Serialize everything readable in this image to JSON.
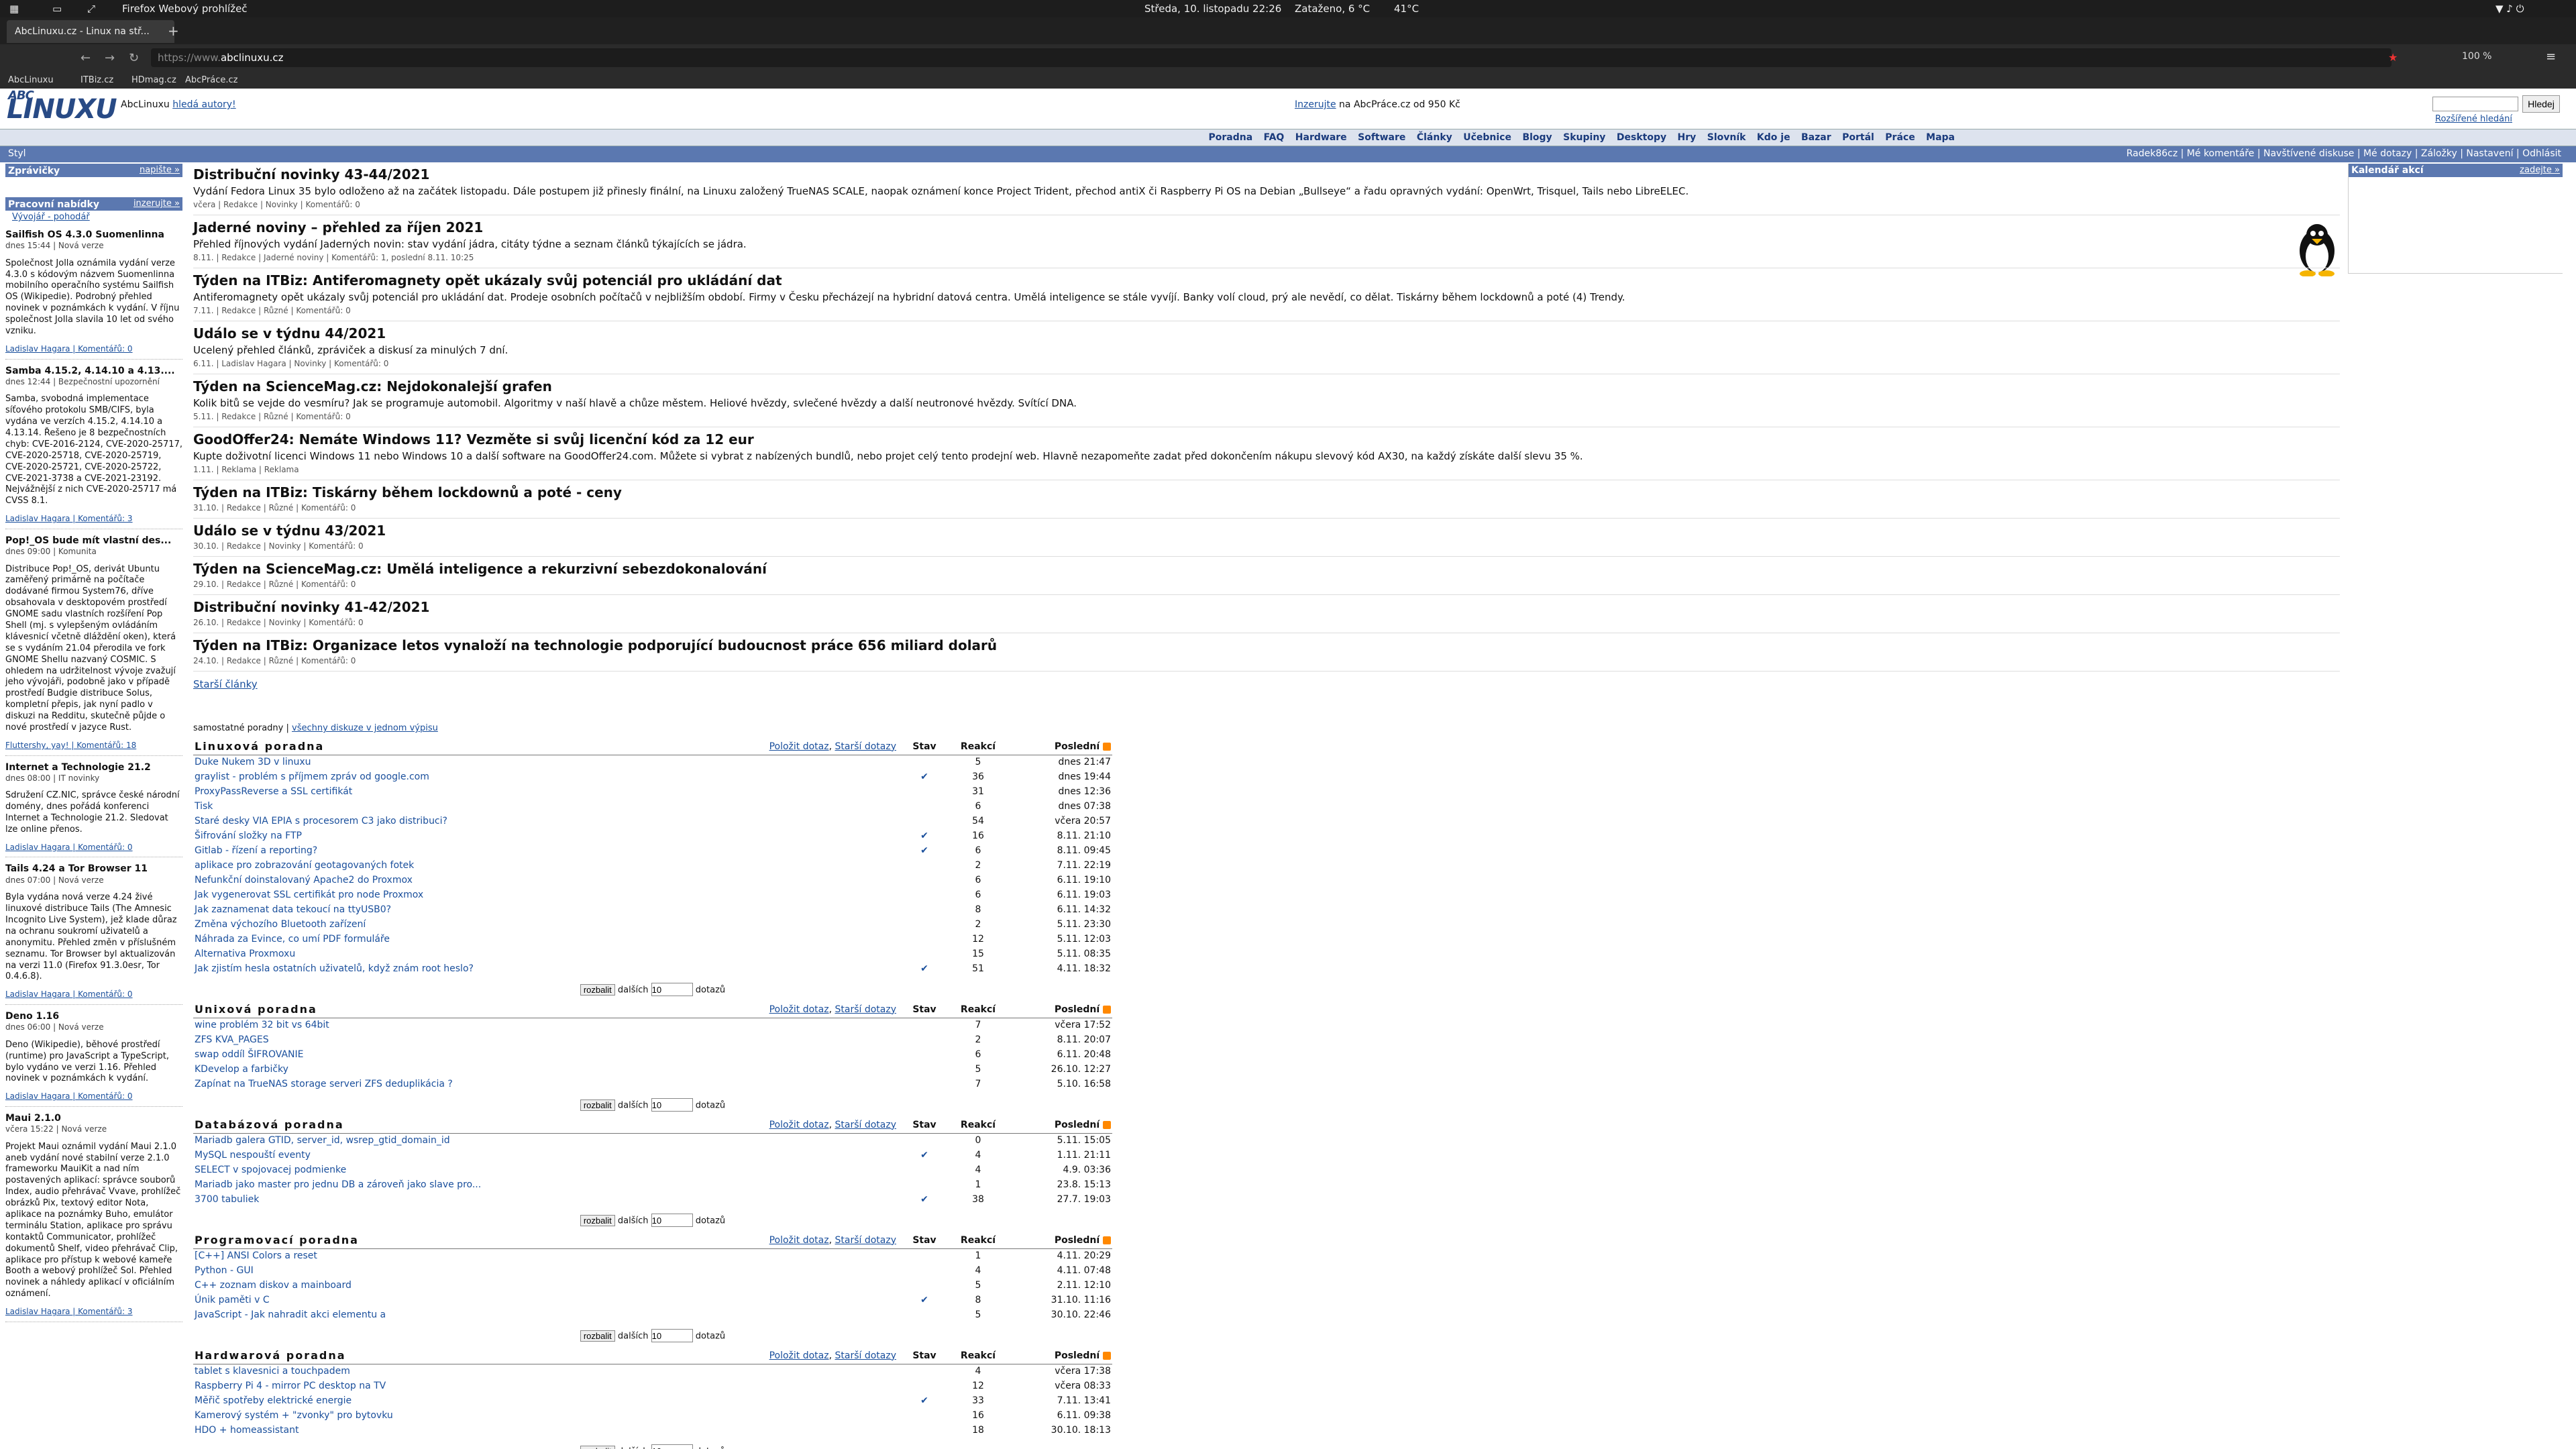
{
  "system_bar": {
    "activities": "Firefox Webový prohlížeč",
    "clock": "Středa, 10. listopadu  22:26",
    "weather": "Zataženo, 6 °C",
    "temp": "41°C"
  },
  "browser": {
    "tab_title": "AbcLinuxu.cz - Linux na stř...",
    "url_prefix": "https://www.",
    "url_domain": "abclinuxu.cz",
    "zoom": "100 %",
    "bookmarks": [
      "AbcLinuxu",
      "ITBiz.cz",
      "HDmag.cz",
      "AbcPráce.cz"
    ]
  },
  "site": {
    "logo_top": "ABC",
    "logo": "LINUXU",
    "slogan_prefix": "AbcLinuxu ",
    "slogan_link": "hledá autory!",
    "ad_link": "Inzerujte",
    "ad_text": " na AbcPráce.cz od 950 Kč",
    "search_button": "Hledej",
    "search_advanced": "Rozšířené hledání",
    "menu": [
      "Poradna",
      "FAQ",
      "Hardware",
      "Software",
      "Články",
      "Učebnice",
      "Blogy",
      "Skupiny",
      "Desktopy",
      "Hry",
      "Slovník",
      "Kdo je",
      "Bazar",
      "Portál",
      "Práce",
      "Mapa"
    ],
    "style_label": "Styl",
    "user_menu": "Radek86cz | Mé komentáře | Navštívené diskuse | Mé dotazy | Záložky | Nastavení | Odhlásit"
  },
  "left": {
    "zpravicky": "Zprávičky",
    "napiste": "napište »",
    "nabidky": "Pracovní nabídky",
    "inzerujte": "inzerujte »",
    "job": "Vývojář - pohodář",
    "news": [
      {
        "title": "Sailfish OS 4.3.0 Suomenlinna",
        "meta": "dnes 15:44 | Nová verze",
        "text": "Společnost Jolla oznámila vydání verze 4.3.0 s kódovým názvem Suomenlinna mobilního operačního systému Sailfish OS (Wikipedie). Podrobný přehled novinek v poznámkách k vydání. V říjnu společnost Jolla slavila 10 let od svého vzniku.",
        "foot": "Ladislav Hagara | Komentářů: 0"
      },
      {
        "title": "Samba 4.15.2, 4.14.10 a 4.13....",
        "meta": "dnes 12:44 | Bezpečnostní upozornění",
        "text": "Samba, svobodná implementace síťového protokolu SMB/CIFS, byla vydána ve verzích 4.15.2, 4.14.10 a 4.13.14. Řešeno je 8 bezpečnostních chyb: CVE-2016-2124, CVE-2020-25717, CVE-2020-25718, CVE-2020-25719, CVE-2020-25721, CVE-2020-25722, CVE-2021-3738 a CVE-2021-23192. Nejvážnější z nich CVE-2020-25717 má CVSS 8.1.",
        "foot": "Ladislav Hagara | Komentářů: 3"
      },
      {
        "title": "Pop!_OS bude mít vlastní des...",
        "meta": "dnes 09:00 | Komunita",
        "text": "Distribuce Pop!_OS, derivát Ubuntu zaměřený primárně na počítače dodávané firmou System76, dříve obsahovala v desktopovém prostředí GNOME sadu vlastních rozšíření Pop Shell (mj. s vylepšeným ovládáním klávesnicí včetně dláždění oken), která se s vydáním 21.04 přerodila ve fork GNOME Shellu nazvaný COSMIC. S ohledem na udržitelnost vývoje zvažují jeho vývojáři, podobně jako v případě prostředí Budgie distribuce Solus, kompletní přepis, jak nyní padlo v diskuzi na Redditu, skutečně půjde o nové prostředí v jazyce Rust.",
        "foot": "Fluttershy, yay! | Komentářů: 18"
      },
      {
        "title": "Internet a Technologie 21.2",
        "meta": "dnes 08:00 | IT novinky",
        "text": "Sdružení CZ.NIC, správce české národní domény, dnes pořádá konferenci Internet a Technologie 21.2. Sledovat lze online přenos.",
        "foot": "Ladislav Hagara | Komentářů: 0"
      },
      {
        "title": "Tails 4.24 a Tor Browser 11",
        "meta": "dnes 07:00 | Nová verze",
        "text": "Byla vydána nová verze 4.24 živé linuxové distribuce Tails (The Amnesic Incognito Live System), jež klade důraz na ochranu soukromí uživatelů a anonymitu. Přehled změn v příslušném seznamu. Tor Browser byl aktualizován na verzi 11.0 (Firefox 91.3.0esr, Tor 0.4.6.8).",
        "foot": "Ladislav Hagara | Komentářů: 0"
      },
      {
        "title": "Deno 1.16",
        "meta": "dnes 06:00 | Nová verze",
        "text": "Deno (Wikipedie), běhové prostředí (runtime) pro JavaScript a TypeScript, bylo vydáno ve verzi 1.16. Přehled novinek v poznámkách k vydání.",
        "foot": "Ladislav Hagara | Komentářů: 0"
      },
      {
        "title": "Maui 2.1.0",
        "meta": "včera 15:22 | Nová verze",
        "text": "Projekt Maui oznámil vydání Maui 2.1.0 aneb vydání nové stabilní verze 2.1.0 frameworku MauiKit a nad ním postavených aplikací: správce souborů Index, audio přehrávač Vvave, prohlížeč obrázků Pix, textový editor Nota, aplikace na poznámky Buho, emulátor terminálu Station, aplikace pro správu kontaktů Communicator, prohlížeč dokumentů Shelf, video přehrávač Clip, aplikace pro přístup k webové kameře Booth a webový prohlížeč Sol. Přehled novinek a náhledy aplikací v oficiálním oznámení.",
        "foot": "Ladislav Hagara | Komentářů: 3"
      }
    ]
  },
  "calendar": {
    "title": "Kalendář akcí",
    "link": "zadejte »"
  },
  "articles": [
    {
      "title": "Distribuční novinky 43-44/2021",
      "text": "Vydání Fedora Linux 35 bylo odloženo až na začátek listopadu. Dále postupem již přinesly finální, na Linuxu založený TrueNAS SCALE, naopak oznámení konce Project Trident, přechod antiX či Raspberry Pi OS na Debian „Bullseye“ a řadu opravných vydání: OpenWrt, Trisquel, Tails nebo LibreELEC.",
      "meta": "včera | Redakce | Novinky | Komentářů: 0"
    },
    {
      "title": "Jaderné noviny – přehled za říjen 2021",
      "text": "Přehled říjnových vydání Jaderných novin: stav vydání jádra, citáty týdne a seznam článků týkajících se jádra.",
      "meta": "8.11. | Redakce | Jaderné noviny | Komentářů: 1, poslední 8.11. 10:25"
    },
    {
      "title": "Týden na ITBiz: Antiferomagnety opět ukázaly svůj potenciál pro ukládání dat",
      "text": "Antiferomagnety opět ukázaly svůj potenciál pro ukládání dat. Prodeje osobních počítačů v nejbližším období. Firmy v Česku přecházejí na hybridní datová centra. Umělá inteligence se stále vyvíjí. Banky volí cloud, prý ale nevědí, co dělat. Tiskárny během lockdownů a poté (4) Trendy.",
      "meta": "7.11. | Redakce | Různé | Komentářů: 0"
    },
    {
      "title": "Událo se v týdnu 44/2021",
      "text": "Ucelený přehled článků, zpráviček a diskusí za minulých 7 dní.",
      "meta": "6.11. | Ladislav Hagara | Novinky | Komentářů: 0"
    },
    {
      "title": "Týden na ScienceMag.cz: Nejdokonalejší grafen",
      "text": "Kolik bitů se vejde do vesmíru? Jak se programuje automobil. Algoritmy v naší hlavě a chůze městem. Heliové hvězdy, svlečené hvězdy a další neutronové hvězdy. Svítící DNA.",
      "meta": "5.11. | Redakce | Různé | Komentářů: 0"
    },
    {
      "title": "GoodOffer24: Nemáte Windows 11? Vezměte si svůj licenční kód za 12 eur",
      "text": "Kupte doživotní licenci Windows 11 nebo Windows 10 a další software na GoodOffer24.com. Můžete si vybrat z nabízených bundlů, nebo projet celý tento prodejní web. Hlavně nezapomeňte zadat před dokončením nákupu slevový kód AX30, na každý získáte další slevu 35 %.",
      "meta": "1.11. | Reklama | Reklama"
    },
    {
      "title": "Týden na ITBiz: Tiskárny během lockdownů a poté - ceny",
      "text": "",
      "meta": "31.10. | Redakce | Různé | Komentářů: 0"
    },
    {
      "title": "Událo se v týdnu 43/2021",
      "text": "",
      "meta": "30.10. | Redakce | Novinky | Komentářů: 0"
    },
    {
      "title": "Týden na ScienceMag.cz: Umělá inteligence a rekurzivní sebezdokonalování",
      "text": "",
      "meta": "29.10. | Redakce | Různé | Komentářů: 0"
    },
    {
      "title": "Distribuční novinky 41-42/2021",
      "text": "",
      "meta": "26.10. | Redakce | Novinky | Komentářů: 0"
    },
    {
      "title": "Týden na ITBiz: Organizace letos vynaloží na technologie podporující budoucnost práce 656 miliard dolarů",
      "text": "",
      "meta": "24.10. | Redakce | Různé | Komentářů: 0"
    }
  ],
  "older_articles": "Starší články",
  "forums_intro_a": "samostatné poradny | ",
  "forums_intro_b": "všechny diskuze v jednom výpisu",
  "forum_cols": {
    "stav": "Stav",
    "reakci": "Reakcí",
    "posledni": "Poslední",
    "ask": "Položit dotaz",
    "older": "Starší dotazy"
  },
  "forum_ctl": {
    "btn": "rozbalit",
    "dalsich": "dalších",
    "value": "10",
    "dotazu": "dotazů"
  },
  "forums": [
    {
      "name": "Linuxová poradna",
      "rows": [
        [
          "Duke Nukem 3D v linuxu",
          "",
          "5",
          "dnes 21:47"
        ],
        [
          "graylist - problém s příjmem zpráv od google.com",
          "✔",
          "36",
          "dnes 19:44"
        ],
        [
          "ProxyPassReverse a SSL certifikát",
          "",
          "31",
          "dnes 12:36"
        ],
        [
          "Tisk",
          "",
          "6",
          "dnes 07:38"
        ],
        [
          "Staré desky VIA EPIA s procesorem C3 jako distribuci?",
          "",
          "54",
          "včera 20:57"
        ],
        [
          "Šifrování složky na FTP",
          "✔",
          "16",
          "8.11. 21:10"
        ],
        [
          "Gitlab - řízení a reporting?",
          "✔",
          "6",
          "8.11. 09:45"
        ],
        [
          "aplikace pro zobrazování geotagovaných fotek",
          "",
          "2",
          "7.11. 22:19"
        ],
        [
          "Nefunkční doinstalovaný Apache2 do Proxmox",
          "",
          "6",
          "6.11. 19:10"
        ],
        [
          "Jak vygenerovat SSL certifikát pro node Proxmox",
          "",
          "6",
          "6.11. 19:03"
        ],
        [
          "Jak zaznamenat data tekoucí na ttyUSB0?",
          "",
          "8",
          "6.11. 14:32"
        ],
        [
          "Změna výchozího Bluetooth zařízení",
          "",
          "2",
          "5.11. 23:30"
        ],
        [
          "Náhrada za Evince, co umí PDF formuláře",
          "",
          "12",
          "5.11. 12:03"
        ],
        [
          "Alternativa Proxmoxu",
          "",
          "15",
          "5.11. 08:35"
        ],
        [
          "Jak zjistím hesla ostatních uživatelů, když znám root heslo?",
          "✔",
          "51",
          "4.11. 18:32"
        ]
      ]
    },
    {
      "name": "Unixová poradna",
      "rows": [
        [
          "wine problém 32 bit vs 64bit",
          "",
          "7",
          "včera 17:52"
        ],
        [
          "ZFS KVA_PAGES",
          "",
          "2",
          "8.11. 20:07"
        ],
        [
          "swap oddíl ŠIFROVANIE",
          "",
          "6",
          "6.11. 20:48"
        ],
        [
          "KDevelop a farbičky",
          "",
          "5",
          "26.10. 12:27"
        ],
        [
          "Zapínat na TrueNAS storage serveri ZFS deduplikácia ?",
          "",
          "7",
          "5.10. 16:58"
        ]
      ]
    },
    {
      "name": "Databázová poradna",
      "rows": [
        [
          "Mariadb galera GTID, server_id, wsrep_gtid_domain_id",
          "",
          "0",
          "5.11. 15:05"
        ],
        [
          "MySQL nespouští eventy",
          "✔",
          "4",
          "1.11. 21:11"
        ],
        [
          "SELECT v spojovacej podmienke",
          "",
          "4",
          "4.9. 03:36"
        ],
        [
          "Mariadb jako master pro jednu DB a zároveň jako slave pro...",
          "",
          "1",
          "23.8. 15:13"
        ],
        [
          "3700 tabuliek",
          "✔",
          "38",
          "27.7. 19:03"
        ]
      ]
    },
    {
      "name": "Programovací poradna",
      "rows": [
        [
          "[C++] ANSI Colors a reset",
          "",
          "1",
          "4.11. 20:29"
        ],
        [
          "Python - GUI",
          "",
          "4",
          "4.11. 07:48"
        ],
        [
          "C++ zoznam diskov a mainboard",
          "",
          "5",
          "2.11. 12:10"
        ],
        [
          "Únik paměti v C",
          "✔",
          "8",
          "31.10. 11:16"
        ],
        [
          "JavaScript - Jak nahradit akci elementu a",
          "",
          "5",
          "30.10. 22:46"
        ]
      ]
    },
    {
      "name": "Hardwarová poradna",
      "rows": [
        [
          "tablet s klavesnici a touchpadem",
          "",
          "4",
          "včera 17:38"
        ],
        [
          "Raspberry Pi 4 - mirror PC desktop na TV",
          "",
          "12",
          "včera 08:33"
        ],
        [
          "Měřič spotřeby elektrické energie",
          "✔",
          "33",
          "7.11. 13:41"
        ],
        [
          "Kamerový systém + \"zvonky\" pro bytovku",
          "",
          "16",
          "6.11. 09:38"
        ],
        [
          "HDO + homeassistant",
          "",
          "18",
          "30.10. 18:13"
        ]
      ]
    }
  ]
}
